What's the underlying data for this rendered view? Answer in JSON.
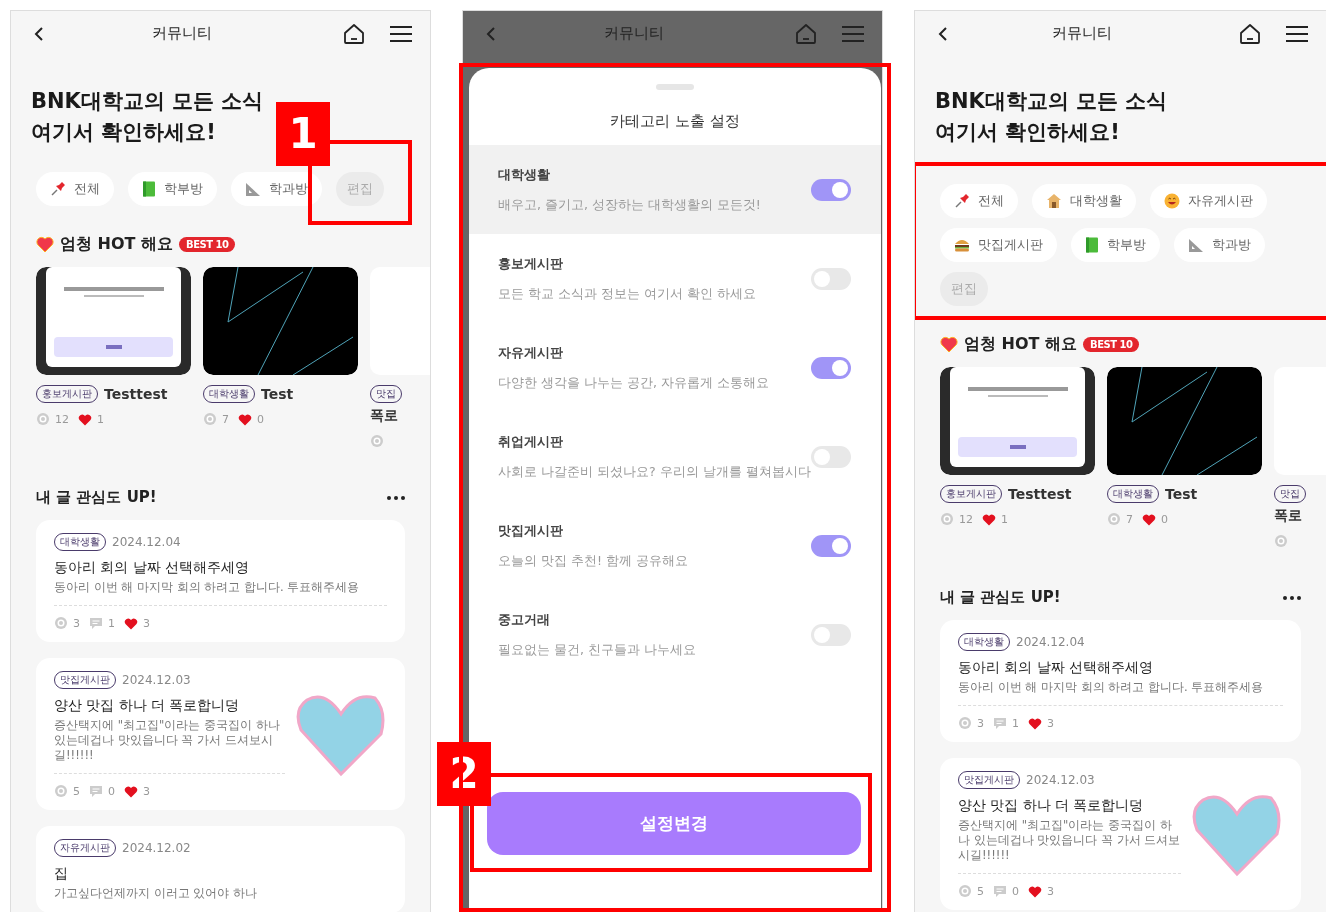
{
  "screens": [
    {
      "kind": "feed",
      "header": {
        "title": "커뮤니티",
        "dimmed": false
      },
      "headline": [
        "BNK대학교의 모든 소식",
        "여기서 확인하세요!"
      ],
      "categories": [
        {
          "label": "전체"
        },
        {
          "label": "학부방"
        },
        {
          "label": "학과방"
        }
      ],
      "edit_label": "편집",
      "edit_marker": {
        "label": "1"
      },
      "hot": {
        "title": "엄청 HOT 해요",
        "badge": "BEST 10",
        "posts": [
          {
            "tag": "홍보게시판",
            "title": "Testtest",
            "views": "12",
            "likes": "1"
          },
          {
            "tag": "대학생활",
            "title": "Test",
            "views": "7",
            "likes": "0"
          },
          {
            "tag": "맛집",
            "title": "폭로"
          }
        ]
      },
      "interest": {
        "title": "내 글 관심도 UP!",
        "posts": [
          {
            "tag": "대학생활",
            "date": "2024.12.04",
            "title": "동아리 회의 날짜 선택해주세영",
            "body": "동아리 이번 해 마지막 회의 하려고 합니다. 투표해주세용",
            "views": "3",
            "comments": "1",
            "likes": "3",
            "has_image": false
          },
          {
            "tag": "맛집게시판",
            "date": "2024.12.03",
            "title": "양산 맛집 하나 더 폭로합니덩",
            "body": "증산택지에  \"최고집\"이라는 중국집이 하나 있는데겁나 맛있읍니다 꼭 가서 드셔보시길!!!!!!",
            "views": "5",
            "comments": "0",
            "likes": "3",
            "has_image": true
          },
          {
            "tag": "자유게시판",
            "date": "2024.12.02",
            "title": "집",
            "body": "가고싶다언제까지 이러고 있어야 하나",
            "has_image": false
          }
        ]
      }
    },
    {
      "kind": "sheet",
      "header": {
        "title": "커뮤니티",
        "dimmed": true
      },
      "sheet_title": "카테고리 노출 설정",
      "sheet_marked": true,
      "rows": [
        {
          "name": "대학생활",
          "desc": "배우고, 즐기고, 성장하는 대학생활의 모든것!",
          "on": true,
          "highlighted": true
        },
        {
          "name": "홍보게시판",
          "desc": "모든 학교 소식과 정보는 여기서 확인 하세요",
          "on": false,
          "highlighted": false
        },
        {
          "name": "자유게시판",
          "desc": "다양한 생각을 나누는 공간, 자유롭게 소통해요",
          "on": true,
          "highlighted": false
        },
        {
          "name": "취업게시판",
          "desc": "사회로 나갈준비 되셨나요? 우리의 날개를 펼쳐봅시다",
          "on": false,
          "highlighted": false
        },
        {
          "name": "맛집게시판",
          "desc": "오늘의 맛집 추천! 함께 공유해요",
          "on": true,
          "highlighted": false
        },
        {
          "name": "중고거래",
          "desc": "필요없는 물건, 친구들과 나누세요",
          "on": false,
          "highlighted": false
        }
      ],
      "button": "설정변경",
      "button_marker": {
        "label": "2"
      }
    },
    {
      "kind": "feed",
      "header": {
        "title": "커뮤니티",
        "dimmed": false
      },
      "headline": [
        "BNK대학교의 모든 소식",
        "여기서 확인하세요!"
      ],
      "categories": [
        {
          "label": "전체"
        },
        {
          "label": "대학생활"
        },
        {
          "label": "자유게시판"
        },
        {
          "label": "맛집게시판"
        },
        {
          "label": "학부방"
        },
        {
          "label": "학과방"
        }
      ],
      "edit_label": "편집",
      "categories_marked": true,
      "hot": {
        "title": "엄청 HOT 해요",
        "badge": "BEST 10",
        "posts": [
          {
            "tag": "홍보게시판",
            "title": "Testtest",
            "views": "12",
            "likes": "1"
          },
          {
            "tag": "대학생활",
            "title": "Test",
            "views": "7",
            "likes": "0"
          },
          {
            "tag": "맛집",
            "title": "폭로"
          }
        ]
      },
      "interest": {
        "title": "내 글 관심도 UP!",
        "posts": [
          {
            "tag": "대학생활",
            "date": "2024.12.04",
            "title": "동아리 회의 날짜 선택해주세영",
            "body": "동아리 이번 해 마지막 회의 하려고 합니다. 투표해주세용",
            "views": "3",
            "comments": "1",
            "likes": "3",
            "has_image": false
          },
          {
            "tag": "맛집게시판",
            "date": "2024.12.03",
            "title": "양산 맛집 하나 더 폭로합니덩",
            "body": "증산택지에  \"최고집\"이라는 중국집이 하나 있는데겁나 맛있읍니다 꼭 가서 드셔보시길!!!!!!",
            "views": "5",
            "comments": "0",
            "likes": "3",
            "has_image": true
          }
        ]
      }
    }
  ]
}
